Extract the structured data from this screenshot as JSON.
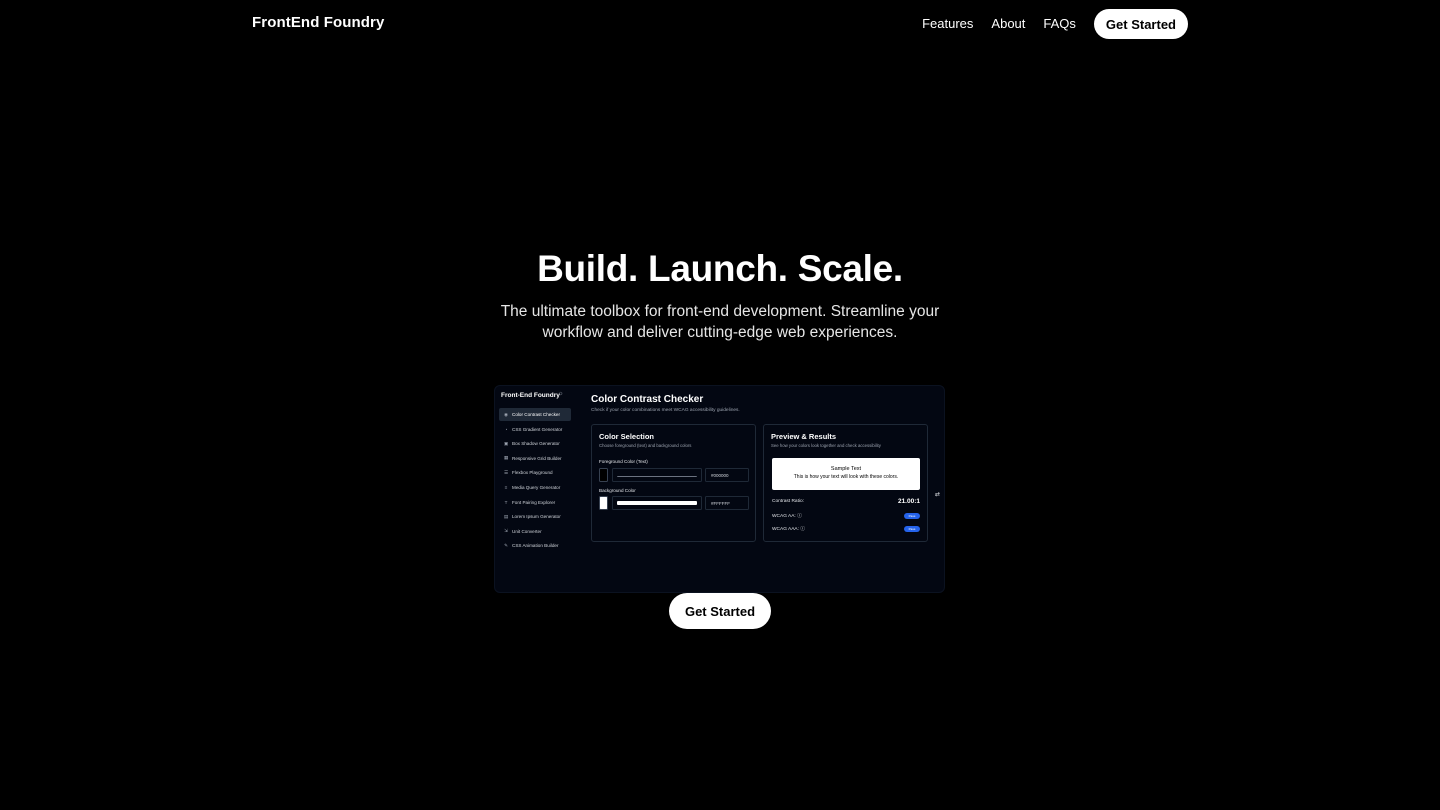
{
  "nav": {
    "brand": "FrontEnd Foundry",
    "links": [
      "Features",
      "About",
      "FAQs"
    ],
    "cta": "Get Started"
  },
  "hero": {
    "title": "Build. Launch. Scale.",
    "subtitle": "The ultimate toolbox for front-end development. Streamline your workflow and deliver cutting-edge web experiences.",
    "cta": "Get Started"
  },
  "preview": {
    "brand": "Front-End Foundry",
    "sidebar": [
      {
        "label": "Color Contrast Checker",
        "icon": "eye-icon"
      },
      {
        "label": "CSS Gradient Generator",
        "icon": "palette-icon"
      },
      {
        "label": "Box Shadow Generator",
        "icon": "box-icon"
      },
      {
        "label": "Responsive Grid Builder",
        "icon": "grid-icon"
      },
      {
        "label": "Flexbox Playground",
        "icon": "list-icon"
      },
      {
        "label": "Media Query Generator",
        "icon": "sliders-icon"
      },
      {
        "label": "Font Pairing Explorer",
        "icon": "type-icon"
      },
      {
        "label": "Lorem Ipsum Generator",
        "icon": "document-icon"
      },
      {
        "label": "Unit Converter",
        "icon": "ruler-icon"
      },
      {
        "label": "CSS Animation Builder",
        "icon": "pen-icon"
      }
    ],
    "title": "Color Contrast Checker",
    "description": "Check if your color combinations meet WCAG accessibility guidelines.",
    "selection": {
      "title": "Color Selection",
      "subtitle": "Choose foreground (text) and background colors",
      "fg_label": "Foreground Color (Text)",
      "fg_hex": "#000000",
      "fg_color": "#000000",
      "bg_label": "Background Color",
      "bg_hex": "#FFFFFF",
      "bg_color": "#FFFFFF"
    },
    "results": {
      "title": "Preview & Results",
      "subtitle": "See how your colors look together and check accessibility",
      "sample_title": "Sample Text",
      "sample_body": "This is how your text will look with these colors.",
      "ratio_label": "Contrast Ratio:",
      "ratio_value": "21.00:1",
      "aa_label": "WCAG AA:",
      "aa_badge": "Pass",
      "aaa_label": "WCAG AAA:",
      "aaa_badge": "Pass"
    }
  }
}
